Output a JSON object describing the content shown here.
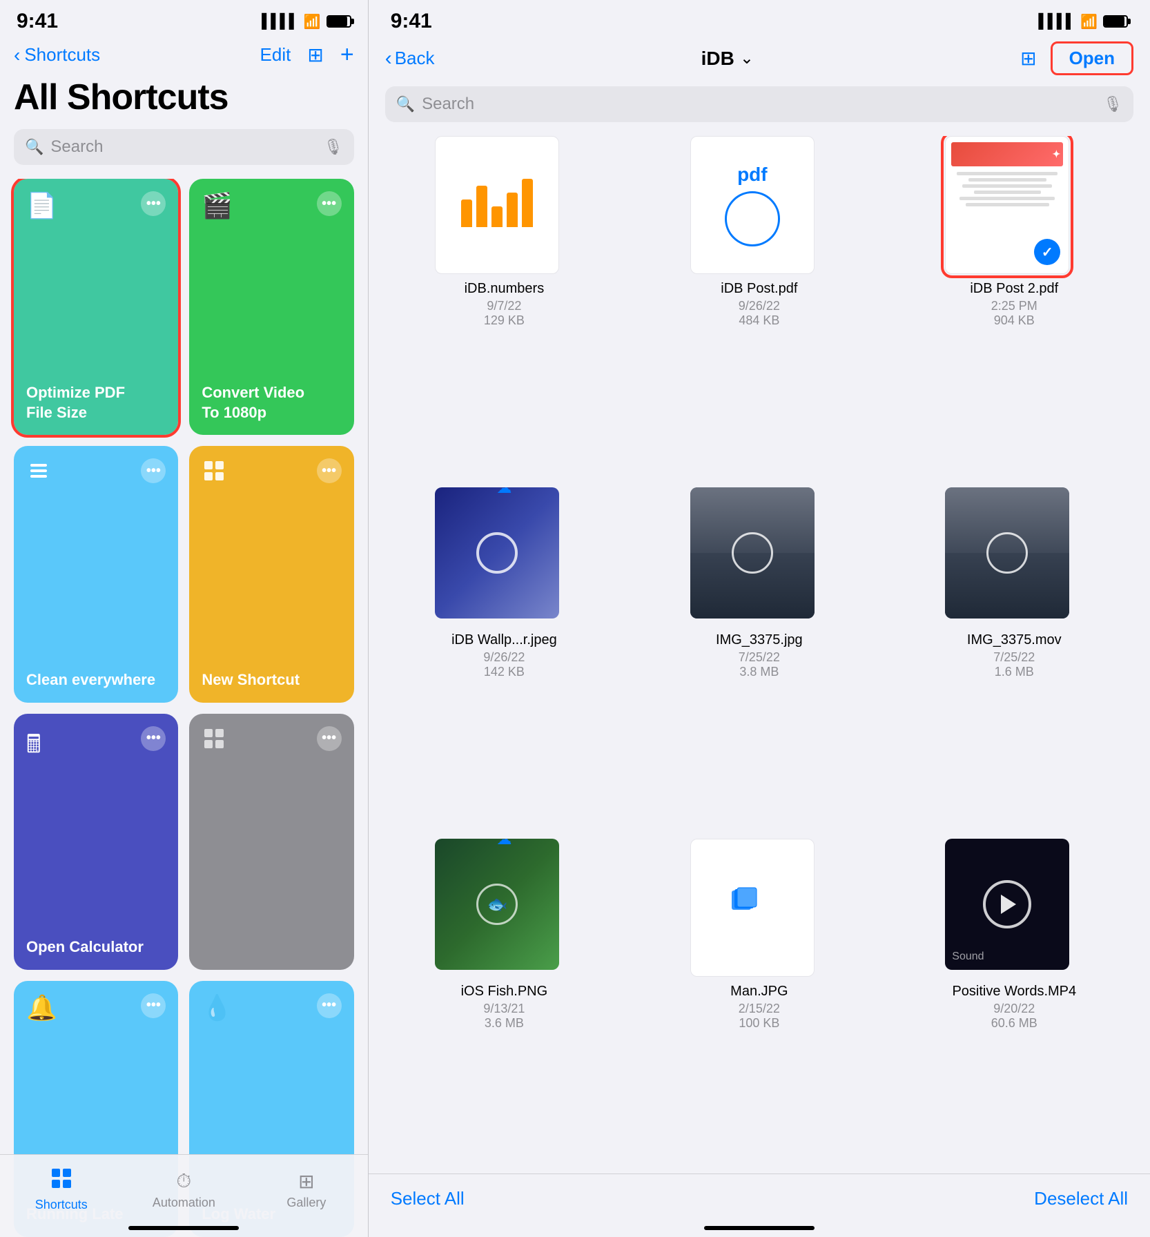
{
  "left": {
    "statusBar": {
      "time": "9:41",
      "signal": "▋▋▋▋",
      "wifi": "wifi",
      "battery": "battery"
    },
    "nav": {
      "backLabel": "Shortcuts",
      "editLabel": "Edit",
      "gridIcon": "⊞",
      "plusIcon": "+"
    },
    "title": "All Shortcuts",
    "search": {
      "placeholder": "Search"
    },
    "shortcuts": [
      {
        "id": "optimize-pdf",
        "label": "Optimize PDF File Size",
        "icon": "📄",
        "color": "teal-green",
        "selected": true
      },
      {
        "id": "convert-video",
        "label": "Convert Video To 1080p",
        "icon": "🎬",
        "color": "green",
        "selected": false
      },
      {
        "id": "clean-everywhere",
        "label": "Clean everywhere",
        "icon": "layers",
        "color": "teal",
        "selected": false
      },
      {
        "id": "new-shortcut",
        "label": "New Shortcut",
        "icon": "layers",
        "color": "yellow",
        "selected": false
      },
      {
        "id": "open-calculator",
        "label": "Open Calculator",
        "icon": "🖩",
        "color": "indigo",
        "selected": false
      },
      {
        "id": "untitled",
        "label": "",
        "icon": "layers",
        "color": "gray",
        "selected": false
      },
      {
        "id": "running-late",
        "label": "Running Late",
        "icon": "🔔",
        "color": "light-blue",
        "selected": false
      },
      {
        "id": "log-water",
        "label": "Log Water",
        "icon": "💧",
        "color": "teal",
        "selected": false
      }
    ],
    "tabBar": {
      "shortcuts": "Shortcuts",
      "automation": "Automation",
      "gallery": "Gallery"
    }
  },
  "right": {
    "statusBar": {
      "time": "9:41"
    },
    "nav": {
      "backLabel": "Back",
      "title": "iDB",
      "openLabel": "Open"
    },
    "search": {
      "placeholder": "Search"
    },
    "files": [
      {
        "id": "idb-numbers",
        "name": "iDB.numbers",
        "date": "9/7/22",
        "size": "129 KB",
        "type": "numbers",
        "hasCloud": false
      },
      {
        "id": "idb-post-pdf",
        "name": "iDB Post.pdf",
        "date": "9/26/22",
        "size": "484 KB",
        "type": "pdf",
        "hasCloud": true
      },
      {
        "id": "idb-post-2-pdf",
        "name": "iDB Post 2.pdf",
        "date": "2:25 PM",
        "size": "904 KB",
        "type": "pdf2",
        "hasCloud": false,
        "selected": true
      },
      {
        "id": "idb-wallpaper",
        "name": "iDB Wallp...r.jpeg",
        "date": "9/26/22",
        "size": "142 KB",
        "type": "wallpaper",
        "hasCloud": true
      },
      {
        "id": "img-3375-jpg",
        "name": "IMG_3375.jpg",
        "date": "7/25/22",
        "size": "3.8 MB",
        "type": "photo-curtain",
        "hasCloud": false
      },
      {
        "id": "img-3375-mov",
        "name": "IMG_3375.mov",
        "date": "7/25/22",
        "size": "1.6 MB",
        "type": "video-curtain",
        "hasCloud": false
      },
      {
        "id": "ios-fish",
        "name": "iOS Fish.PNG",
        "date": "9/13/21",
        "size": "3.6 MB",
        "type": "photo-fish",
        "hasCloud": true
      },
      {
        "id": "man-jpg",
        "name": "Man.JPG",
        "date": "2/15/22",
        "size": "100 KB",
        "type": "pdf-white",
        "hasCloud": true
      },
      {
        "id": "positive-words",
        "name": "Positive Words.MP4",
        "date": "9/20/22",
        "size": "60.6 MB",
        "type": "video-dark",
        "hasCloud": false
      }
    ],
    "bottomActions": {
      "selectAll": "Select All",
      "deselectAll": "Deselect All"
    }
  }
}
